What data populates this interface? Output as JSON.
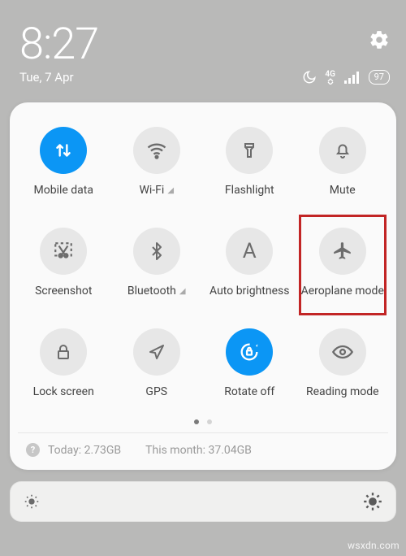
{
  "status": {
    "time": "8:27",
    "date": "Tue, 7 Apr",
    "network_gen": "4G",
    "battery": "97"
  },
  "tiles": [
    {
      "label": "Mobile data",
      "active": true,
      "icon": "data"
    },
    {
      "label": "Wi-Fi",
      "active": false,
      "icon": "wifi",
      "chevron": true
    },
    {
      "label": "Flashlight",
      "active": false,
      "icon": "flashlight"
    },
    {
      "label": "Mute",
      "active": false,
      "icon": "mute"
    },
    {
      "label": "Screenshot",
      "active": false,
      "icon": "screenshot"
    },
    {
      "label": "Bluetooth",
      "active": false,
      "icon": "bluetooth",
      "chevron": true
    },
    {
      "label": "Auto brightness",
      "active": false,
      "icon": "autobright"
    },
    {
      "label": "Aeroplane mode",
      "active": false,
      "icon": "airplane",
      "highlight": true
    },
    {
      "label": "Lock screen",
      "active": false,
      "icon": "lock"
    },
    {
      "label": "GPS",
      "active": false,
      "icon": "gps"
    },
    {
      "label": "Rotate off",
      "active": true,
      "icon": "rotate"
    },
    {
      "label": "Reading mode",
      "active": false,
      "icon": "reading"
    }
  ],
  "usage": {
    "today_label": "Today:",
    "today_value": "2.73GB",
    "month_label": "This month:",
    "month_value": "37.04GB"
  },
  "watermark": "wsxdn.com"
}
